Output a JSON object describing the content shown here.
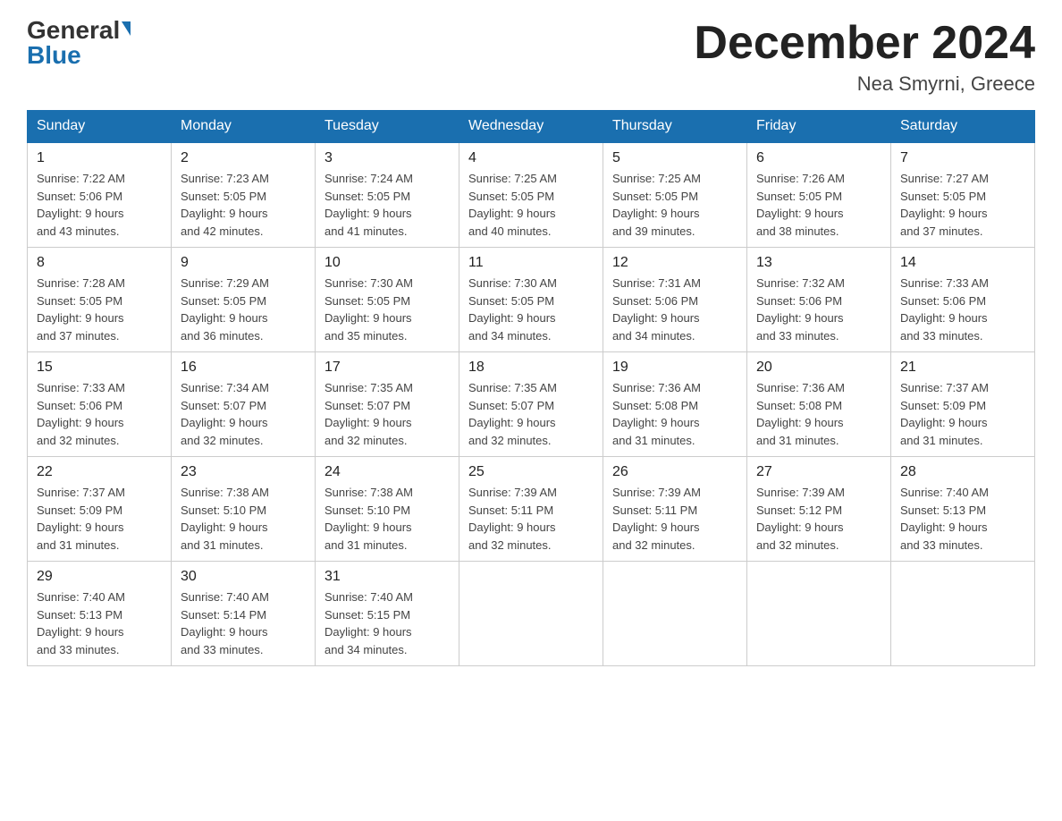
{
  "logo": {
    "general": "General",
    "blue": "Blue"
  },
  "title": "December 2024",
  "location": "Nea Smyrni, Greece",
  "days_of_week": [
    "Sunday",
    "Monday",
    "Tuesday",
    "Wednesday",
    "Thursday",
    "Friday",
    "Saturday"
  ],
  "weeks": [
    [
      {
        "day": "1",
        "sunrise": "7:22 AM",
        "sunset": "5:06 PM",
        "daylight": "9 hours and 43 minutes."
      },
      {
        "day": "2",
        "sunrise": "7:23 AM",
        "sunset": "5:05 PM",
        "daylight": "9 hours and 42 minutes."
      },
      {
        "day": "3",
        "sunrise": "7:24 AM",
        "sunset": "5:05 PM",
        "daylight": "9 hours and 41 minutes."
      },
      {
        "day": "4",
        "sunrise": "7:25 AM",
        "sunset": "5:05 PM",
        "daylight": "9 hours and 40 minutes."
      },
      {
        "day": "5",
        "sunrise": "7:25 AM",
        "sunset": "5:05 PM",
        "daylight": "9 hours and 39 minutes."
      },
      {
        "day": "6",
        "sunrise": "7:26 AM",
        "sunset": "5:05 PM",
        "daylight": "9 hours and 38 minutes."
      },
      {
        "day": "7",
        "sunrise": "7:27 AM",
        "sunset": "5:05 PM",
        "daylight": "9 hours and 37 minutes."
      }
    ],
    [
      {
        "day": "8",
        "sunrise": "7:28 AM",
        "sunset": "5:05 PM",
        "daylight": "9 hours and 37 minutes."
      },
      {
        "day": "9",
        "sunrise": "7:29 AM",
        "sunset": "5:05 PM",
        "daylight": "9 hours and 36 minutes."
      },
      {
        "day": "10",
        "sunrise": "7:30 AM",
        "sunset": "5:05 PM",
        "daylight": "9 hours and 35 minutes."
      },
      {
        "day": "11",
        "sunrise": "7:30 AM",
        "sunset": "5:05 PM",
        "daylight": "9 hours and 34 minutes."
      },
      {
        "day": "12",
        "sunrise": "7:31 AM",
        "sunset": "5:06 PM",
        "daylight": "9 hours and 34 minutes."
      },
      {
        "day": "13",
        "sunrise": "7:32 AM",
        "sunset": "5:06 PM",
        "daylight": "9 hours and 33 minutes."
      },
      {
        "day": "14",
        "sunrise": "7:33 AM",
        "sunset": "5:06 PM",
        "daylight": "9 hours and 33 minutes."
      }
    ],
    [
      {
        "day": "15",
        "sunrise": "7:33 AM",
        "sunset": "5:06 PM",
        "daylight": "9 hours and 32 minutes."
      },
      {
        "day": "16",
        "sunrise": "7:34 AM",
        "sunset": "5:07 PM",
        "daylight": "9 hours and 32 minutes."
      },
      {
        "day": "17",
        "sunrise": "7:35 AM",
        "sunset": "5:07 PM",
        "daylight": "9 hours and 32 minutes."
      },
      {
        "day": "18",
        "sunrise": "7:35 AM",
        "sunset": "5:07 PM",
        "daylight": "9 hours and 32 minutes."
      },
      {
        "day": "19",
        "sunrise": "7:36 AM",
        "sunset": "5:08 PM",
        "daylight": "9 hours and 31 minutes."
      },
      {
        "day": "20",
        "sunrise": "7:36 AM",
        "sunset": "5:08 PM",
        "daylight": "9 hours and 31 minutes."
      },
      {
        "day": "21",
        "sunrise": "7:37 AM",
        "sunset": "5:09 PM",
        "daylight": "9 hours and 31 minutes."
      }
    ],
    [
      {
        "day": "22",
        "sunrise": "7:37 AM",
        "sunset": "5:09 PM",
        "daylight": "9 hours and 31 minutes."
      },
      {
        "day": "23",
        "sunrise": "7:38 AM",
        "sunset": "5:10 PM",
        "daylight": "9 hours and 31 minutes."
      },
      {
        "day": "24",
        "sunrise": "7:38 AM",
        "sunset": "5:10 PM",
        "daylight": "9 hours and 31 minutes."
      },
      {
        "day": "25",
        "sunrise": "7:39 AM",
        "sunset": "5:11 PM",
        "daylight": "9 hours and 32 minutes."
      },
      {
        "day": "26",
        "sunrise": "7:39 AM",
        "sunset": "5:11 PM",
        "daylight": "9 hours and 32 minutes."
      },
      {
        "day": "27",
        "sunrise": "7:39 AM",
        "sunset": "5:12 PM",
        "daylight": "9 hours and 32 minutes."
      },
      {
        "day": "28",
        "sunrise": "7:40 AM",
        "sunset": "5:13 PM",
        "daylight": "9 hours and 33 minutes."
      }
    ],
    [
      {
        "day": "29",
        "sunrise": "7:40 AM",
        "sunset": "5:13 PM",
        "daylight": "9 hours and 33 minutes."
      },
      {
        "day": "30",
        "sunrise": "7:40 AM",
        "sunset": "5:14 PM",
        "daylight": "9 hours and 33 minutes."
      },
      {
        "day": "31",
        "sunrise": "7:40 AM",
        "sunset": "5:15 PM",
        "daylight": "9 hours and 34 minutes."
      },
      null,
      null,
      null,
      null
    ]
  ],
  "cell_labels": {
    "sunrise": "Sunrise:",
    "sunset": "Sunset:",
    "daylight": "Daylight:"
  }
}
